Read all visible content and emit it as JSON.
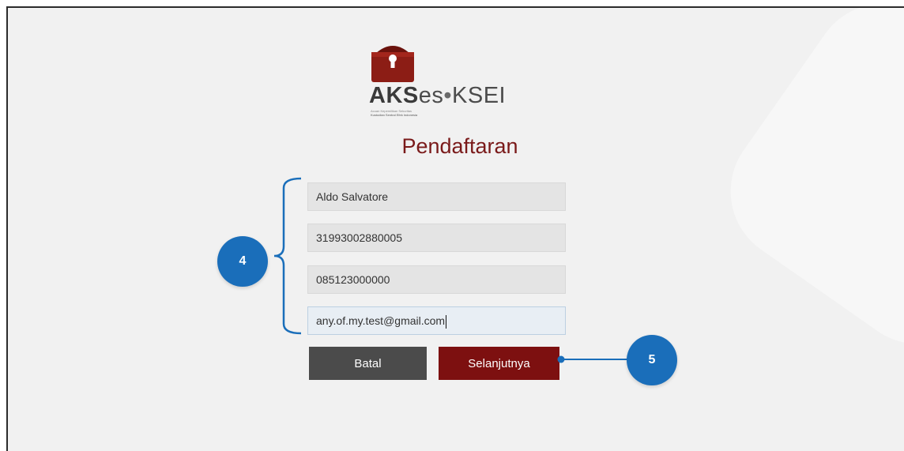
{
  "logo": {
    "brand_bold": "AKS",
    "brand_rest": "es",
    "separator": "•",
    "brand_suffix": "KSEI",
    "tagline_1": "Acuan Kepemilikan Sekuritas",
    "tagline_2": "Kustodian Sentral Efek Indonesia"
  },
  "page_title": "Pendaftaran",
  "form": {
    "name_value": "Aldo Salvatore",
    "id_number_value": "31993002880005",
    "phone_value": "085123000000",
    "email_value": "any.of.my.test@gmail.com"
  },
  "buttons": {
    "cancel_label": "Batal",
    "next_label": "Selanjutnya"
  },
  "annotations": {
    "fields_step": "4",
    "next_step": "5"
  },
  "colors": {
    "accent_red": "#7d1010",
    "title_red": "#7a1a1a",
    "annotation_blue": "#1a6eba",
    "cancel_gray": "#4b4b4b"
  }
}
